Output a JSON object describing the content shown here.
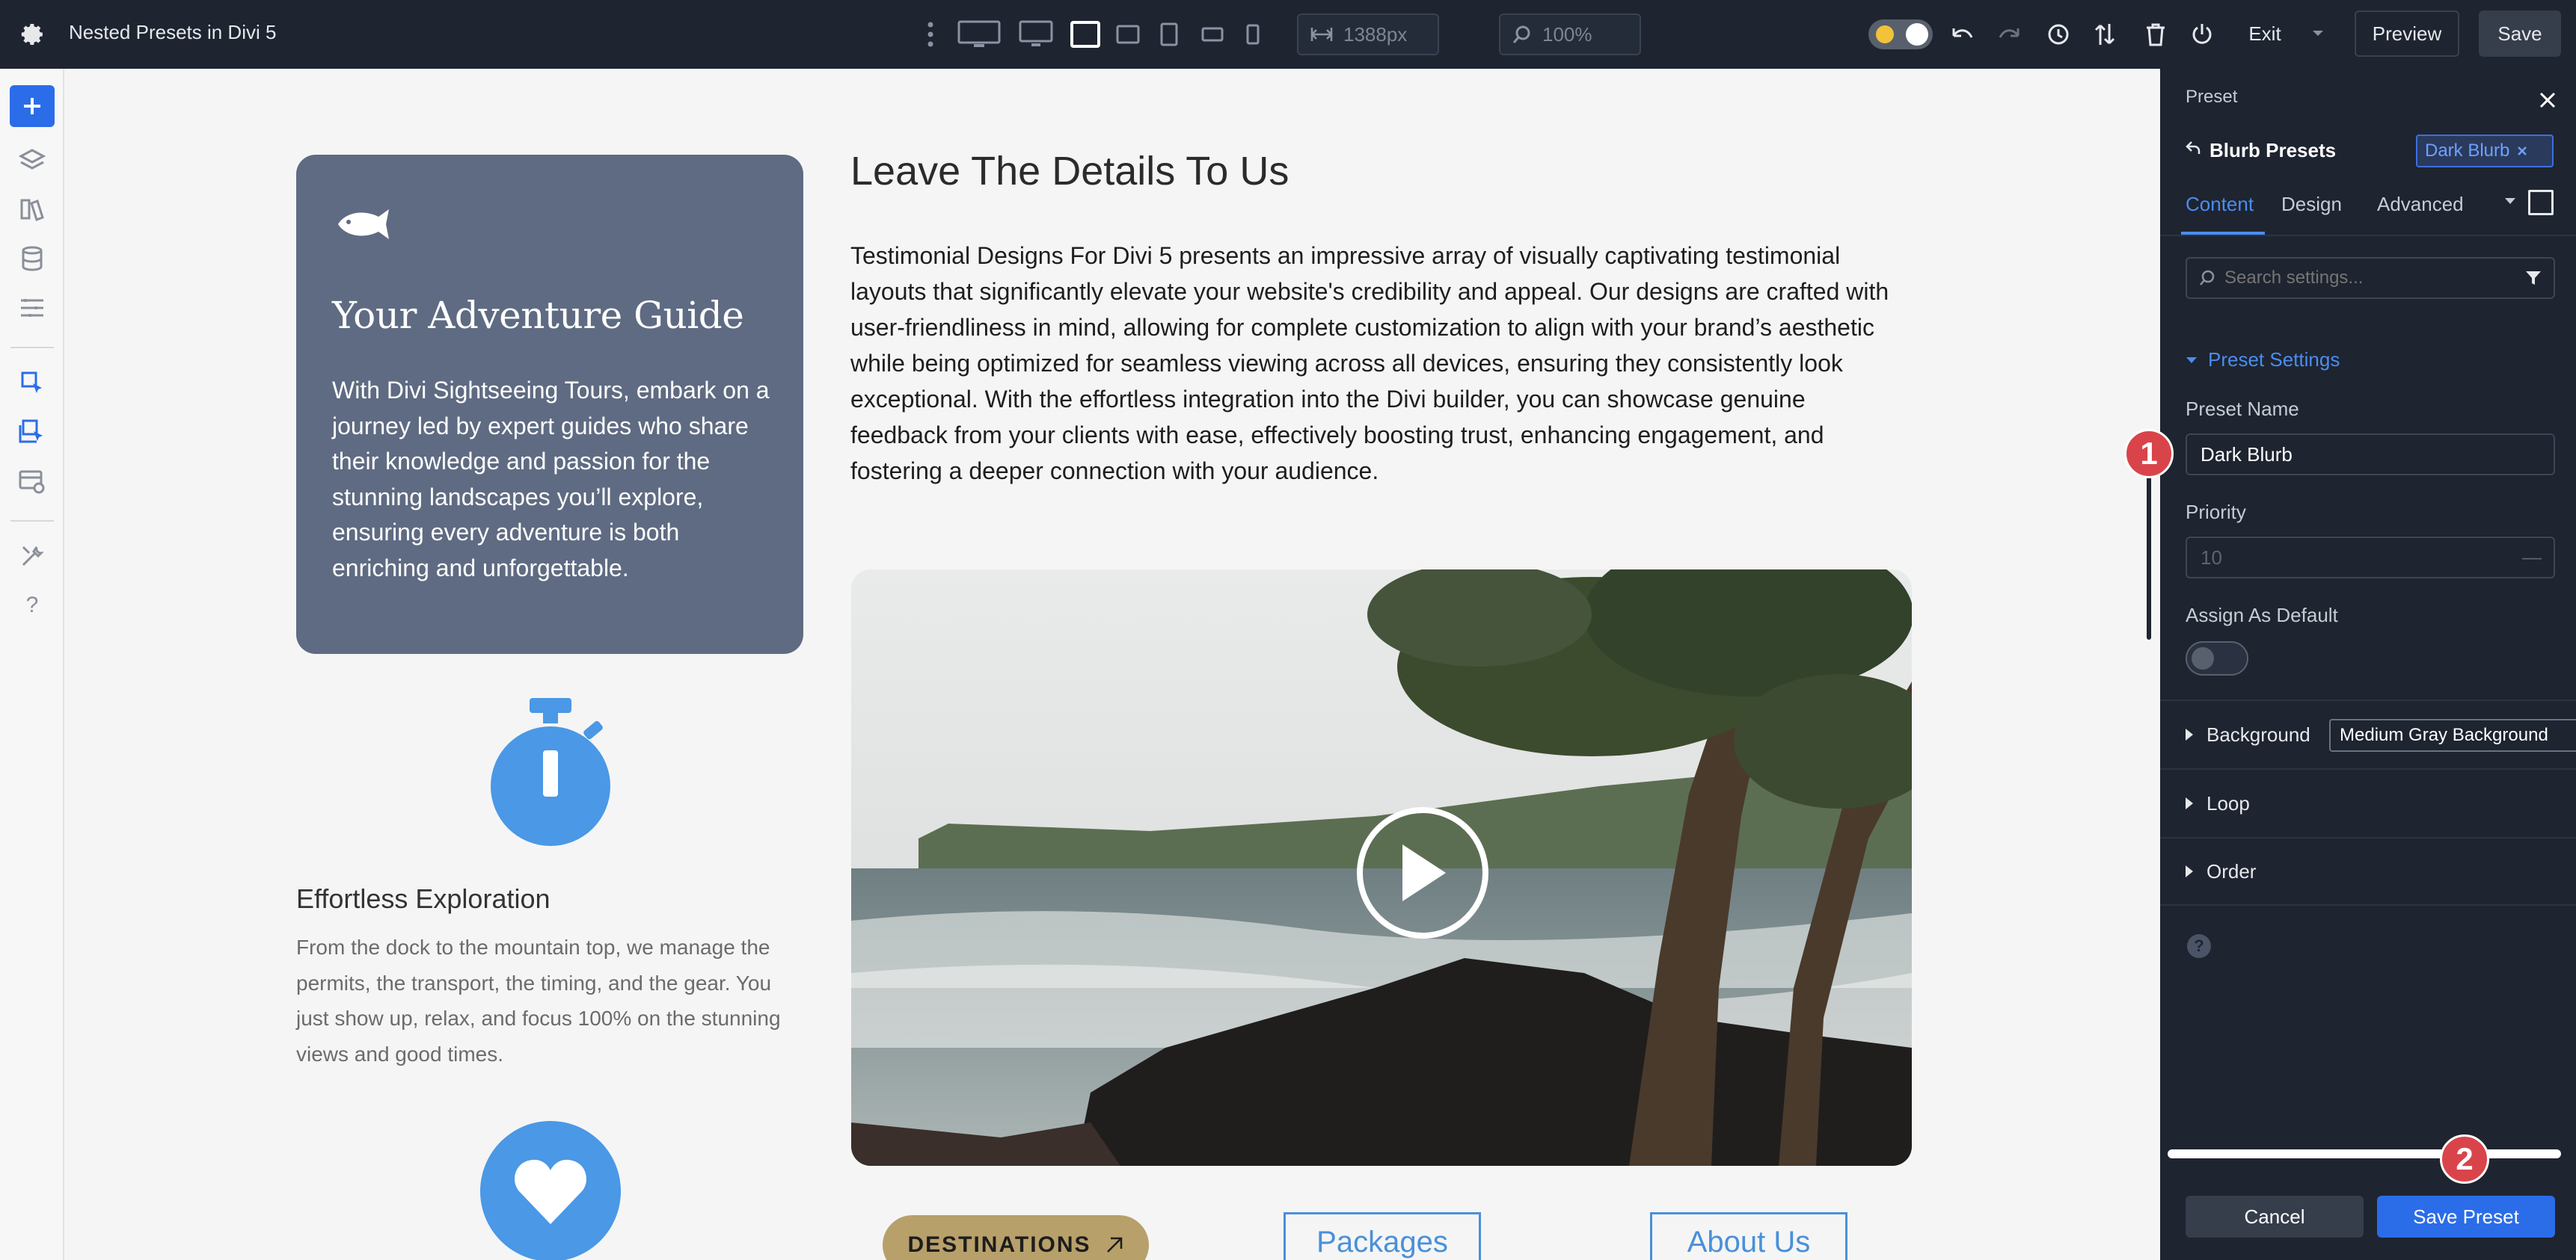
{
  "topbar": {
    "doc_title": "Nested Presets in Divi 5",
    "width_value": "1388px",
    "zoom_value": "100%",
    "exit_label": "Exit",
    "preview_label": "Preview",
    "save_label": "Save"
  },
  "canvas": {
    "blurb_card": {
      "title": "Your Adventure Guide",
      "text": "With Divi Sightseeing Tours, embark on a journey led by expert guides who share their knowledge and passion for the stunning landscapes you’ll explore, ensuring every adventure is both enriching and unforgettable."
    },
    "exploration": {
      "title": "Effortless Exploration",
      "text": "From the dock to the mountain top, we manage the permits, the transport, the timing, and the gear. You just show up, relax, and focus 100% on the stunning views and good times."
    },
    "main_title": "Leave The Details To Us",
    "main_text": "Testimonial Designs For Divi 5 presents an impressive array of visually captivating testimonial layouts that significantly elevate your website's credibility and appeal. Our designs are crafted with user-friendliness in mind, allowing for complete customization to align with your brand’s aesthetic while being optimized for seamless viewing across all devices, ensuring they consistently look exceptional. With the effortless integration into the Divi builder, you can showcase genuine feedback from your clients with ease, effectively boosting trust, enhancing engagement, and fostering a deeper connection with your audience.",
    "buttons": {
      "destinations": "DESTINATIONS",
      "packages": "Packages",
      "about": "About Us"
    }
  },
  "panel": {
    "header": "Preset",
    "breadcrumb": "Blurb Presets",
    "preset_tag": "Dark Blurb",
    "tabs": [
      "Content",
      "Design",
      "Advanced"
    ],
    "search_placeholder": "Search settings...",
    "preset_settings_label": "Preset Settings",
    "preset_name_label": "Preset Name",
    "preset_name_value": "Dark Blurb",
    "priority_label": "Priority",
    "priority_placeholder": "10",
    "assign_default_label": "Assign As Default",
    "background_label": "Background",
    "background_preset": "Medium Gray Background",
    "loop_label": "Loop",
    "order_label": "Order",
    "cancel_label": "Cancel",
    "save_preset_label": "Save Preset",
    "markers": [
      "1",
      "2"
    ]
  },
  "colors": {
    "dark_ui": "#1e2430",
    "accent_blue": "#2b6de8",
    "tab_blue": "#4a8df0",
    "card_slate": "#5f6b82",
    "icon_blue": "#4a98e6",
    "gold": "#b8a06a",
    "marker_red": "#d9444b"
  }
}
